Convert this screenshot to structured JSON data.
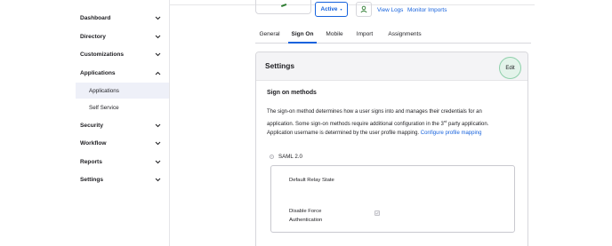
{
  "sidebar": {
    "items": [
      {
        "label": "Dashboard",
        "chevron": "chevron-down"
      },
      {
        "label": "Directory",
        "chevron": "chevron-down"
      },
      {
        "label": "Customizations",
        "chevron": "chevron-down"
      },
      {
        "label": "Applications",
        "chevron": "chevron-up"
      },
      {
        "label": "Security",
        "chevron": "chevron-down"
      },
      {
        "label": "Workflow",
        "chevron": "chevron-down"
      },
      {
        "label": "Reports",
        "chevron": "chevron-down"
      },
      {
        "label": "Settings",
        "chevron": "chevron-down"
      }
    ],
    "subitems": [
      {
        "label": "Applications",
        "active": true
      },
      {
        "label": "Self Service",
        "active": false
      }
    ]
  },
  "header": {
    "status_label": "Active",
    "status_caret": "▾",
    "view_logs_label": "View Logs",
    "monitor_imports_label": "Monitor Imports",
    "icon": "user-sync-icon"
  },
  "tabs": [
    "General",
    "Sign On",
    "Mobile",
    "Import",
    "Assignments"
  ],
  "active_tab": "Sign On",
  "settings": {
    "title": "Settings",
    "edit_label": "Edit",
    "sign_on_title": "Sign on methods",
    "description_line1": "The sign-on method determines how a user signs into and manages their credentials for an",
    "description_line2_pre": "application. Some sign-on methods require additional configuration in the 3",
    "description_sup": "rd",
    "description_line2_post": " party application.",
    "username_text": "Application username is determined by the user profile mapping.",
    "configure_link": "Configure profile mapping",
    "saml_label": "SAML 2.0",
    "relay_state_label": "Default Relay State",
    "force_auth_label_1": "Disable Force",
    "force_auth_label_2": "Authentication"
  },
  "colors": {
    "accent": "#1662dd",
    "edit_bg": "#e3f3ea",
    "edit_border": "#8fd0ab",
    "active_sidebar_bg": "#eef0f8"
  }
}
